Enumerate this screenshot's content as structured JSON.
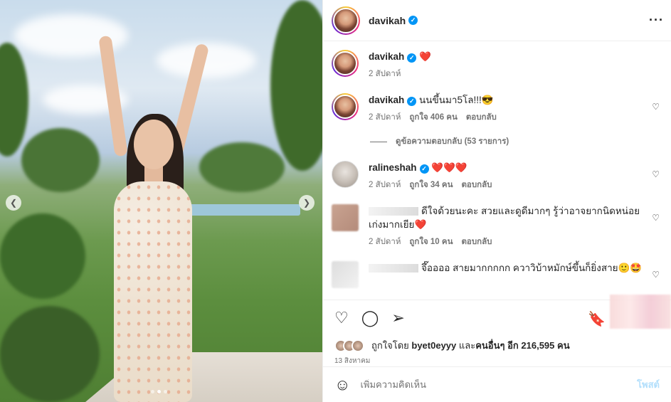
{
  "post": {
    "author": "davikah",
    "like_summary_prefix": "ถูกใจโดย",
    "liked_by_user": "byet0eyyy",
    "like_summary_mid": "และ",
    "others_label": "คนอื่นๆ",
    "others_count_text": "อีก 216,595 คน",
    "date": "13 สิงหาคม",
    "add_comment_placeholder": "เพิ่มความคิดเห็น",
    "post_button": "โพสต์"
  },
  "caption": {
    "username": "davikah",
    "text": "❤️",
    "time": "2 สัปดาห์"
  },
  "comments": [
    {
      "username": "davikah",
      "text": "นนขึ้นมา5โล!!!😎",
      "time": "2 สัปดาห์",
      "likes": "ถูกใจ 406 คน",
      "reply": "ตอบกลับ"
    },
    {
      "username": "ralineshah",
      "text": "❤️❤️❤️",
      "time": "2 สัปดาห์",
      "likes": "ถูกใจ 34 คน",
      "reply": "ตอบกลับ"
    },
    {
      "username": "",
      "text": "ดีใจด้วยนะคะ สวยและดูดีมากๆ รู้ว่าอาจยากนิดหน่อย เก่งมากเยีย❤️",
      "time": "2 สัปดาห์",
      "likes": "ถูกใจ 10 คน",
      "reply": "ตอบกลับ"
    },
    {
      "username": "",
      "text": "จึ๊ออออ สายมากกกกก ควาวิบ้าหมักษ์ขึ้นก็ยิ่งสาย🙂🤩"
    }
  ],
  "view_replies": "ดูข้อความตอบกลับ (53 รายการ)",
  "icons": {
    "more": "more-options-icon",
    "like": "heart-icon",
    "comment": "comment-icon",
    "share": "share-icon",
    "save": "bookmark-icon",
    "emoji": "emoji-icon"
  },
  "colors": {
    "verified": "#0095f6",
    "link_disabled": "#b2dffc",
    "muted": "#737373"
  }
}
